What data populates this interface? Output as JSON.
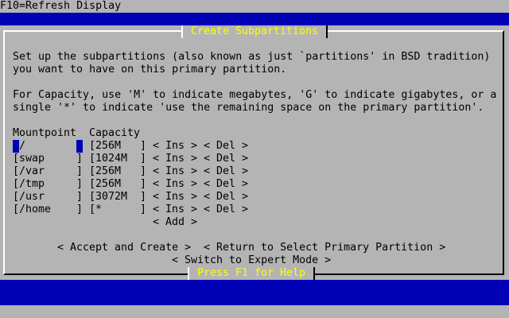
{
  "top_hint": "F10=Refresh Display",
  "dialog_title": "Create Subpartitions",
  "intro_line1": "Set up the subpartitions (also known as just `partitions' in BSD tradition)",
  "intro_line2": "you want to have on this primary partition.",
  "capacity_line1": "For Capacity, use 'M' to indicate megabytes, 'G' to indicate gigabytes, or a",
  "capacity_line2": "single '*' to indicate 'use the remaining space on the primary partition'.",
  "col_mountpoint": "Mountpoint",
  "col_capacity": "Capacity",
  "rows": [
    {
      "mount": "[/        ]",
      "capacity": "[256M   ]",
      "ins": "< Ins >",
      "del": "< Del >"
    },
    {
      "mount": "[swap     ]",
      "capacity": "[1024M  ]",
      "ins": "< Ins >",
      "del": "< Del >"
    },
    {
      "mount": "[/var     ]",
      "capacity": "[256M   ]",
      "ins": "< Ins >",
      "del": "< Del >"
    },
    {
      "mount": "[/tmp     ]",
      "capacity": "[256M   ]",
      "ins": "< Ins >",
      "del": "< Del >"
    },
    {
      "mount": "[/usr     ]",
      "capacity": "[3072M  ]",
      "ins": "< Ins >",
      "del": "< Del >"
    },
    {
      "mount": "[/home    ]",
      "capacity": "[*      ]",
      "ins": "< Ins >",
      "del": "< Del >"
    }
  ],
  "add_button": "< Add >",
  "accept_button": "< Accept and Create >",
  "return_button": "< Return to Select Primary Partition >",
  "expert_button": "< Switch to Expert Mode >",
  "help_hint": "Press F1 for Help",
  "colors": {
    "background": "#b4b4b4",
    "bar": "#0000b4",
    "title": "#ffff00"
  }
}
